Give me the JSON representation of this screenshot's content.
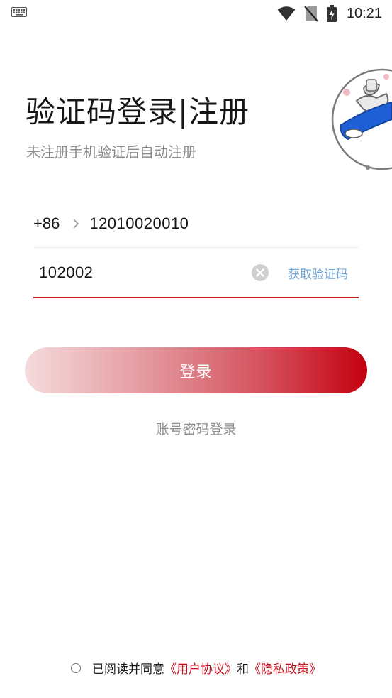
{
  "status_bar": {
    "time": "10:21",
    "icons": [
      "keyboard-icon",
      "wifi-icon",
      "no-sim-icon",
      "battery-charging-icon"
    ]
  },
  "header": {
    "title": "验证码登录|注册",
    "subtitle": "未注册手机验证后自动注册"
  },
  "phone": {
    "country_code": "+86",
    "number": "12010020010"
  },
  "code": {
    "value": "102002",
    "get_code_label": "获取验证码"
  },
  "actions": {
    "login_label": "登录",
    "password_login_label": "账号密码登录"
  },
  "agreement": {
    "prefix": "已阅读并同意",
    "user_agreement": "《用户协议》",
    "conjunction": "和",
    "privacy_policy": "《隐私政策》"
  },
  "colors": {
    "accent_red": "#c4141f",
    "link_blue": "#6ea6d6",
    "subtitle_gray": "#8a8a8a"
  }
}
